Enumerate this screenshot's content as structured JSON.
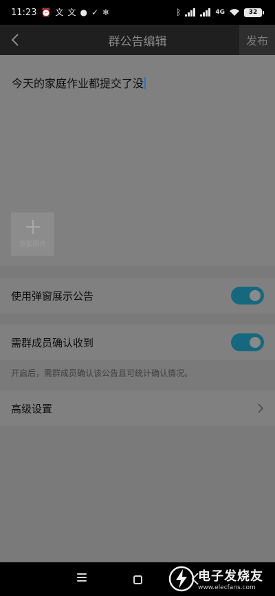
{
  "status_bar": {
    "time": "11:23",
    "battery": "32",
    "network_label": "4G",
    "left_icons": [
      "alarm-icon",
      "translate-icon",
      "translate-icon",
      "app-icon",
      "check-icon",
      "snowflake-icon"
    ],
    "right_icons": [
      "bluetooth-icon",
      "signal-icon",
      "signal-icon",
      "wifi-icon",
      "battery-icon"
    ]
  },
  "header": {
    "title": "群公告编辑",
    "publish_label": "发布",
    "back_icon": "chevron-left-icon"
  },
  "editor": {
    "text": "今天的家庭作业都提交了没"
  },
  "add_photo": {
    "label": "添加照片",
    "icon": "plus-icon"
  },
  "settings": {
    "popup_label": "使用弹窗展示公告",
    "popup_on": true,
    "confirm_label": "需群成员确认收到",
    "confirm_on": true,
    "confirm_hint": "开启后，需群成员确认该公告且可统计确认情况。",
    "advanced_label": "高级设置"
  },
  "watermark": {
    "name": "电子发烧友",
    "url": "www.elecfans.com"
  },
  "colors": {
    "toggle_on": "#15697f",
    "overlay_bg": "#7a7a7b",
    "nav_bg": "#1f1f1f"
  }
}
